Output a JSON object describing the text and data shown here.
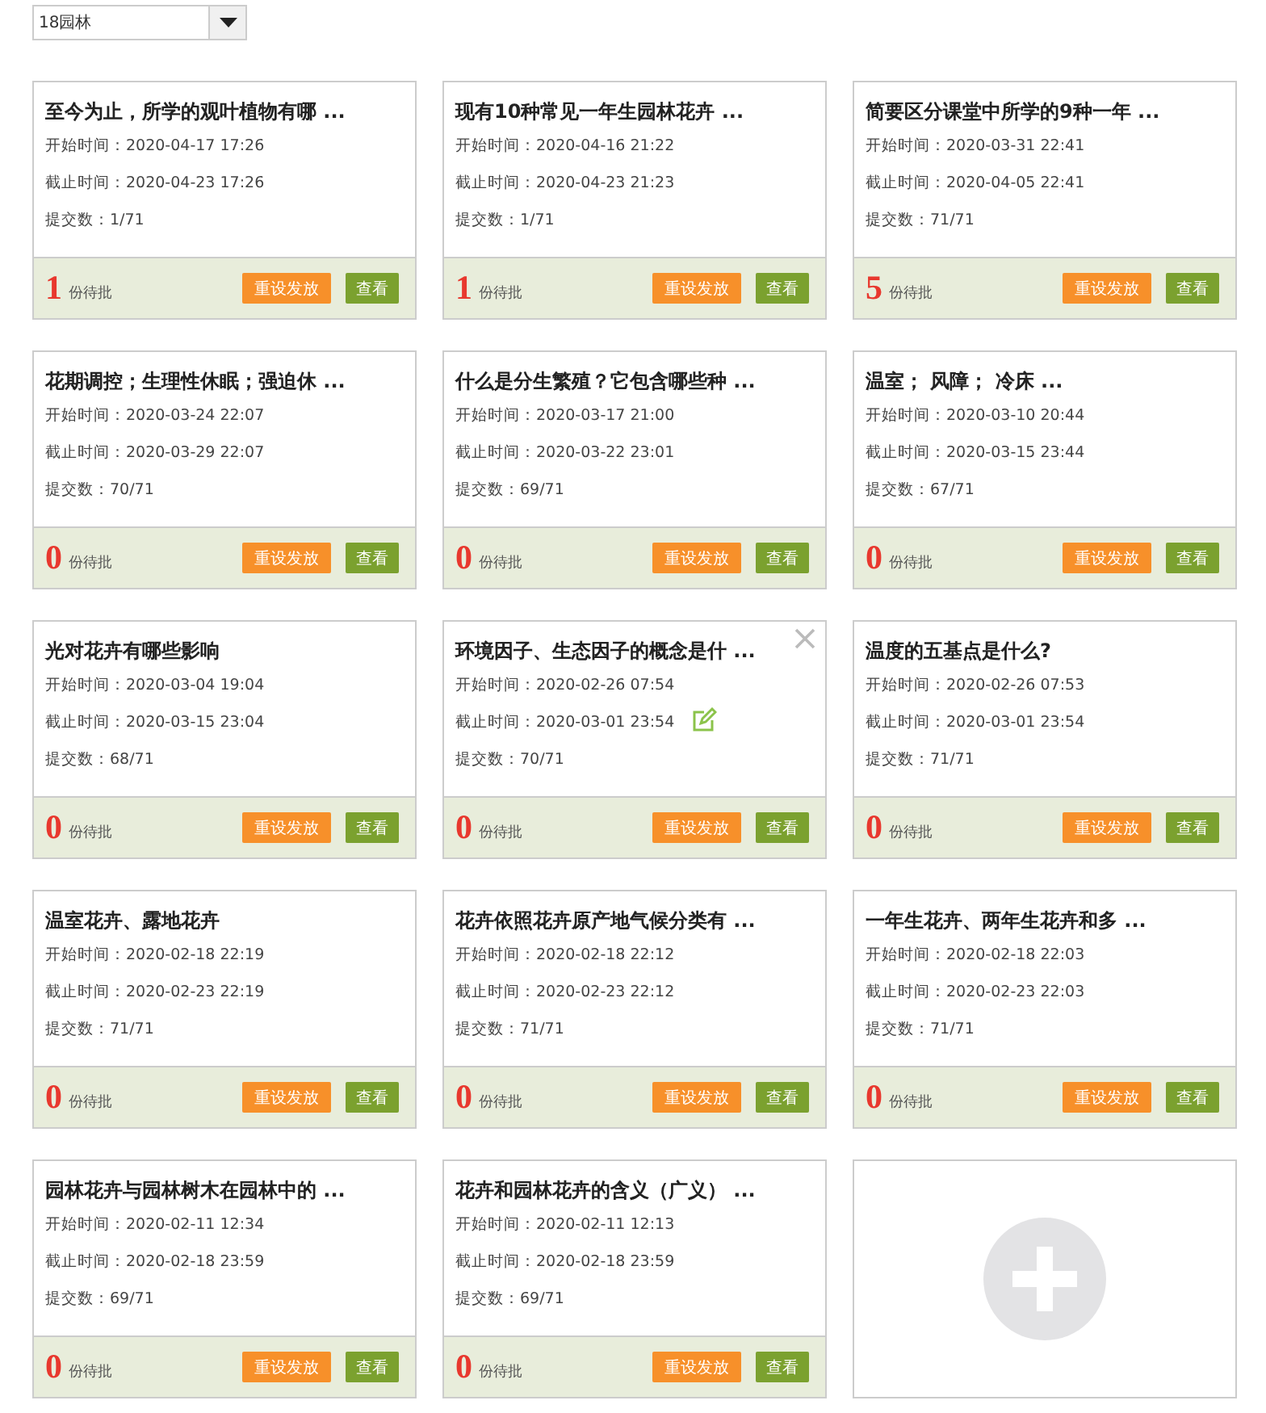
{
  "class_select": {
    "value": "18园林"
  },
  "cards": [
    {
      "title": "至今为止，所学的观叶植物有哪 ...",
      "lines": [
        "开始时间：2020-04-17 17:26",
        "截止时间：2020-04-23 17:26",
        "提交数：1/71"
      ],
      "pending": "1",
      "pending_label": "份待批",
      "buttons": [
        "重设发放",
        "查看"
      ],
      "hovered": false
    },
    {
      "title": "现有10种常见一年生园林花卉 ...",
      "lines": [
        "开始时间：2020-04-16 21:22",
        "截止时间：2020-04-23 21:23",
        "提交数：1/71"
      ],
      "pending": "1",
      "pending_label": "份待批",
      "buttons": [
        "重设发放",
        "查看"
      ],
      "hovered": false
    },
    {
      "title": "简要区分课堂中所学的9种一年 ...",
      "lines": [
        "开始时间：2020-03-31 22:41",
        "截止时间：2020-04-05 22:41",
        "提交数：71/71"
      ],
      "pending": "5",
      "pending_label": "份待批",
      "buttons": [
        "重设发放",
        "查看"
      ],
      "hovered": false
    },
    {
      "title": "花期调控；生理性休眠；强迫休 ...",
      "lines": [
        "开始时间：2020-03-24 22:07",
        "截止时间：2020-03-29 22:07",
        "提交数：70/71"
      ],
      "pending": "0",
      "pending_label": "份待批",
      "buttons": [
        "重设发放",
        "查看"
      ],
      "hovered": false
    },
    {
      "title": "什么是分生繁殖？它包含哪些种 ...",
      "lines": [
        "开始时间：2020-03-17 21:00",
        "截止时间：2020-03-22 23:01",
        "提交数：69/71"
      ],
      "pending": "0",
      "pending_label": "份待批",
      "buttons": [
        "重设发放",
        "查看"
      ],
      "hovered": false
    },
    {
      "title": "温室；  风障；  冷床 ...",
      "lines": [
        "开始时间：2020-03-10 20:44",
        "截止时间：2020-03-15 23:44",
        "提交数：67/71"
      ],
      "pending": "0",
      "pending_label": "份待批",
      "buttons": [
        "重设发放",
        "查看"
      ],
      "hovered": false
    },
    {
      "title": "光对花卉有哪些影响",
      "lines": [
        "开始时间：2020-03-04 19:04",
        "截止时间：2020-03-15 23:04",
        "提交数：68/71"
      ],
      "pending": "0",
      "pending_label": "份待批",
      "buttons": [
        "重设发放",
        "查看"
      ],
      "hovered": false
    },
    {
      "title": "环境因子、生态因子的概念是什 ...",
      "lines": [
        "开始时间：2020-02-26 07:54",
        "截止时间：2020-03-01 23:54",
        "提交数：70/71"
      ],
      "pending": "0",
      "pending_label": "份待批",
      "buttons": [
        "重设发放",
        "查看"
      ],
      "hovered": true
    },
    {
      "title": "温度的五基点是什么?",
      "lines": [
        "开始时间：2020-02-26 07:53",
        "截止时间：2020-03-01 23:54",
        "提交数：71/71"
      ],
      "pending": "0",
      "pending_label": "份待批",
      "buttons": [
        "重设发放",
        "查看"
      ],
      "hovered": false
    },
    {
      "title": "温室花卉、露地花卉",
      "lines": [
        "开始时间：2020-02-18 22:19",
        "截止时间：2020-02-23 22:19",
        "提交数：71/71"
      ],
      "pending": "0",
      "pending_label": "份待批",
      "buttons": [
        "重设发放",
        "查看"
      ],
      "hovered": false
    },
    {
      "title": "花卉依照花卉原产地气候分类有 ...",
      "lines": [
        "开始时间：2020-02-18 22:12",
        "截止时间：2020-02-23 22:12",
        "提交数：71/71"
      ],
      "pending": "0",
      "pending_label": "份待批",
      "buttons": [
        "重设发放",
        "查看"
      ],
      "hovered": false
    },
    {
      "title": "一年生花卉、两年生花卉和多 ...",
      "lines": [
        "开始时间：2020-02-18 22:03",
        "截止时间：2020-02-23 22:03",
        "提交数：71/71"
      ],
      "pending": "0",
      "pending_label": "份待批",
      "buttons": [
        "重设发放",
        "查看"
      ],
      "hovered": false
    },
    {
      "title": "园林花卉与园林树木在园林中的 ...",
      "lines": [
        "开始时间：2020-02-11 12:34",
        "截止时间：2020-02-18 23:59",
        "提交数：69/71"
      ],
      "pending": "0",
      "pending_label": "份待批",
      "buttons": [
        "重设发放",
        "查看"
      ],
      "hovered": false
    },
    {
      "title": "花卉和园林花卉的含义（广义） ...",
      "lines": [
        "开始时间：2020-02-11 12:13",
        "截止时间：2020-02-18 23:59",
        "提交数：69/71"
      ],
      "pending": "0",
      "pending_label": "份待批",
      "buttons": [
        "重设发放",
        "查看"
      ],
      "hovered": false
    }
  ],
  "add_card": {
    "kind": "add"
  }
}
